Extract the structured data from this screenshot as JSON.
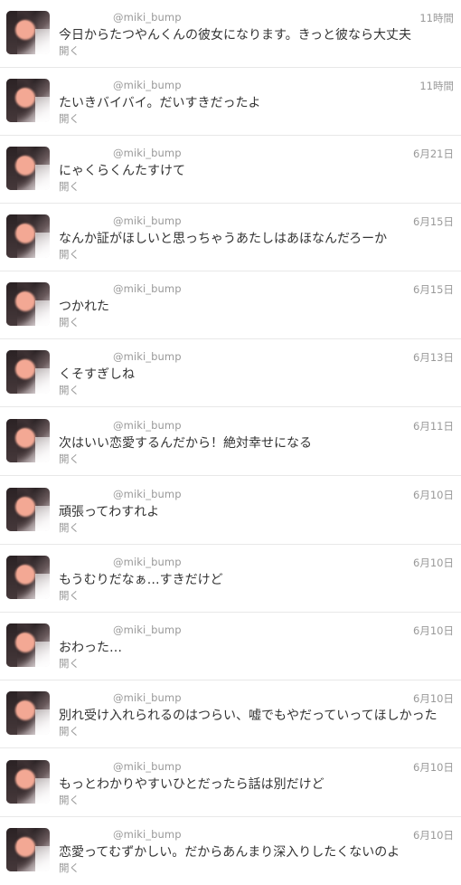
{
  "timeline": {
    "tweets": [
      {
        "username": "@miki_bump",
        "time": "11時間",
        "text": "今日からたつやんくんの彼女になります。きっと彼なら大丈夫",
        "open_label": "開く"
      },
      {
        "username": "@miki_bump",
        "time": "11時間",
        "text": "たいきバイバイ。だいすきだったよ",
        "open_label": "開く"
      },
      {
        "username": "@miki_bump",
        "time": "6月21日",
        "text": "にゃくらくんたすけて",
        "open_label": "開く"
      },
      {
        "username": "@miki_bump",
        "time": "6月15日",
        "text": "なんか証がほしいと思っちゃうあたしはあほなんだろーか",
        "open_label": "開く"
      },
      {
        "username": "@miki_bump",
        "time": "6月15日",
        "text": "つかれた",
        "open_label": "開く"
      },
      {
        "username": "@miki_bump",
        "time": "6月13日",
        "text": "くそすぎしね",
        "open_label": "開く"
      },
      {
        "username": "@miki_bump",
        "time": "6月11日",
        "text": "次はいい恋愛するんだから！絶対幸せになる",
        "open_label": "開く"
      },
      {
        "username": "@miki_bump",
        "time": "6月10日",
        "text": "頑張ってわすれよ",
        "open_label": "開く"
      },
      {
        "username": "@miki_bump",
        "time": "6月10日",
        "text": "もうむりだなぁ…すきだけど",
        "open_label": "開く"
      },
      {
        "username": "@miki_bump",
        "time": "6月10日",
        "text": "おわった…",
        "open_label": "開く"
      },
      {
        "username": "@miki_bump",
        "time": "6月10日",
        "text": "別れ受け入れられるのはつらい、嘘でもやだっていってほしかった",
        "open_label": "開く"
      },
      {
        "username": "@miki_bump",
        "time": "6月10日",
        "text": "もっとわかりやすいひとだったら話は別だけど",
        "open_label": "開く"
      },
      {
        "username": "@miki_bump",
        "time": "6月10日",
        "text": "恋愛ってむずかしい。だからあんまり深入りしたくないのよ",
        "open_label": "開く"
      }
    ]
  }
}
